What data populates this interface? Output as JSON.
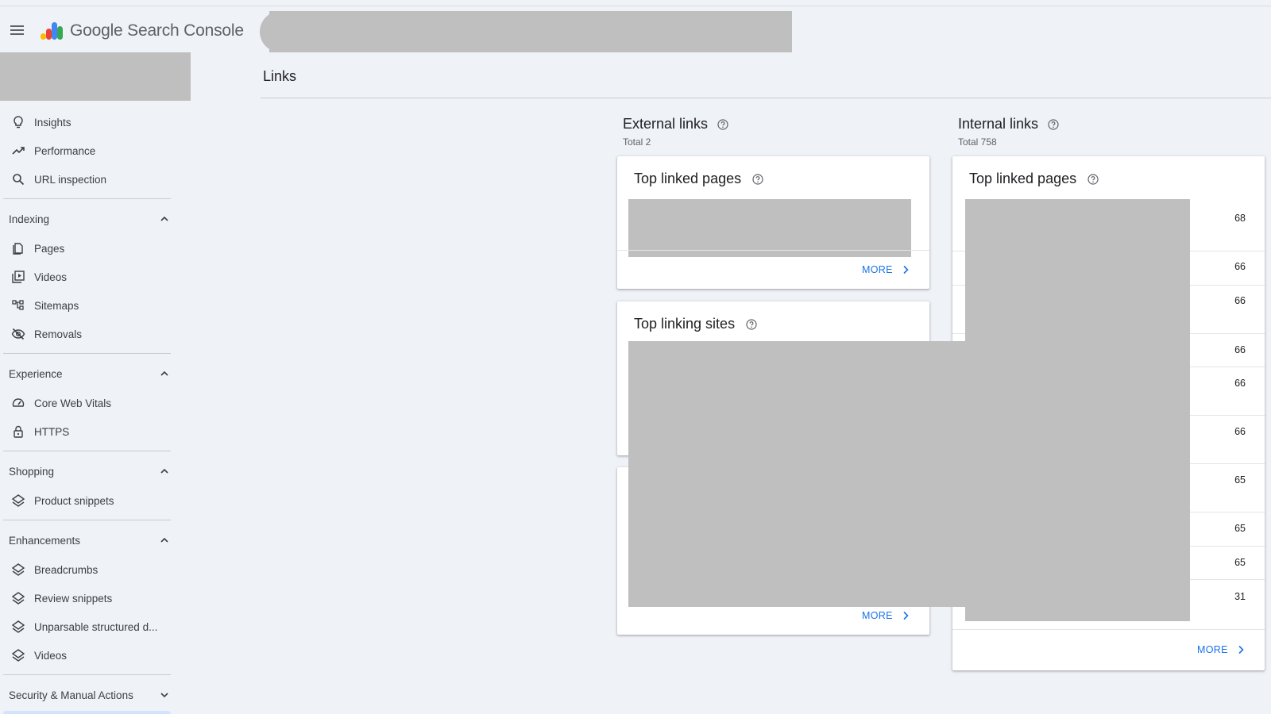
{
  "app": {
    "brand_google": "Google",
    "brand_product": "Search Console"
  },
  "sidebar": {
    "top_items": [
      {
        "label": "Insights",
        "icon": "lightbulb-icon"
      },
      {
        "label": "Performance",
        "icon": "trending-up-icon"
      },
      {
        "label": "URL inspection",
        "icon": "search-icon"
      }
    ],
    "sections": [
      {
        "title": "Indexing",
        "expanded": true,
        "items": [
          {
            "label": "Pages",
            "icon": "pages-icon"
          },
          {
            "label": "Videos",
            "icon": "video-library-icon"
          },
          {
            "label": "Sitemaps",
            "icon": "sitemap-icon"
          },
          {
            "label": "Removals",
            "icon": "visibility-off-icon"
          }
        ]
      },
      {
        "title": "Experience",
        "expanded": true,
        "items": [
          {
            "label": "Core Web Vitals",
            "icon": "speed-gauge-icon"
          },
          {
            "label": "HTTPS",
            "icon": "lock-icon"
          }
        ]
      },
      {
        "title": "Shopping",
        "expanded": true,
        "items": [
          {
            "label": "Product snippets",
            "icon": "layers-icon"
          }
        ]
      },
      {
        "title": "Enhancements",
        "expanded": true,
        "items": [
          {
            "label": "Breadcrumbs",
            "icon": "layers-icon"
          },
          {
            "label": "Review snippets",
            "icon": "layers-icon"
          },
          {
            "label": "Unparsable structured d...",
            "icon": "layers-icon"
          },
          {
            "label": "Videos",
            "icon": "layers-icon"
          }
        ]
      },
      {
        "title": "Security & Manual Actions",
        "expanded": false,
        "items": []
      }
    ]
  },
  "main": {
    "page_title": "Links",
    "external": {
      "title": "External links",
      "total": "Total 2",
      "top_linked_pages": {
        "title": "Top linked pages",
        "more": "MORE"
      },
      "top_linking_sites": {
        "title": "Top linking sites",
        "more": "MORE"
      }
    },
    "internal": {
      "title": "Internal links",
      "total": "Total 758",
      "top_linked_pages": {
        "title": "Top linked pages",
        "more": "MORE",
        "counts": [
          "68",
          "66",
          "66",
          "66",
          "66",
          "66",
          "65",
          "65",
          "65",
          "31"
        ]
      }
    }
  },
  "colors": {
    "background": "#eff2f7",
    "accent": "#1a73e8",
    "redaction": "#bfbfbf"
  }
}
